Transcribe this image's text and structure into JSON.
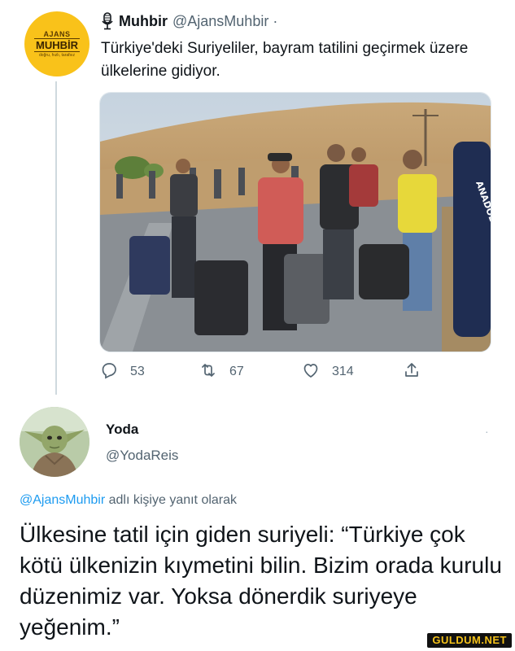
{
  "tweet1": {
    "avatar": {
      "line1": "AJANS",
      "line2": "MUHBİR",
      "line3": "doğru, hızlı, tarafsız"
    },
    "name": "Muhbir",
    "handle": "@AjansMuhbir ·",
    "text": "Türkiye'deki Suriyeliler, bayram tatilini geçirmek üzere ülkelerine gidiyor.",
    "photo": {
      "sign_text": "ANADOLU"
    },
    "actions": {
      "replies": "53",
      "retweets": "67",
      "likes": "314"
    }
  },
  "tweet2": {
    "name": "Yoda",
    "handle": "@YodaReis",
    "more": "·",
    "reply_to": {
      "handle": "@AjansMuhbir",
      "suffix": " adlı kişiye yanıt olarak"
    },
    "text": "Ülkesine tatil için giden suriyeli: “Türkiye çok kötü ülkenizin kıymetini bilin. Bizim orada kurulu düzenimiz var. Yoksa dönerdik suriyeye yeğenim.”"
  },
  "watermark": "GULDUM.NET",
  "colors": {
    "link": "#1d9bf0",
    "muted": "#536471",
    "avatar_yellow": "#f9c21a"
  }
}
